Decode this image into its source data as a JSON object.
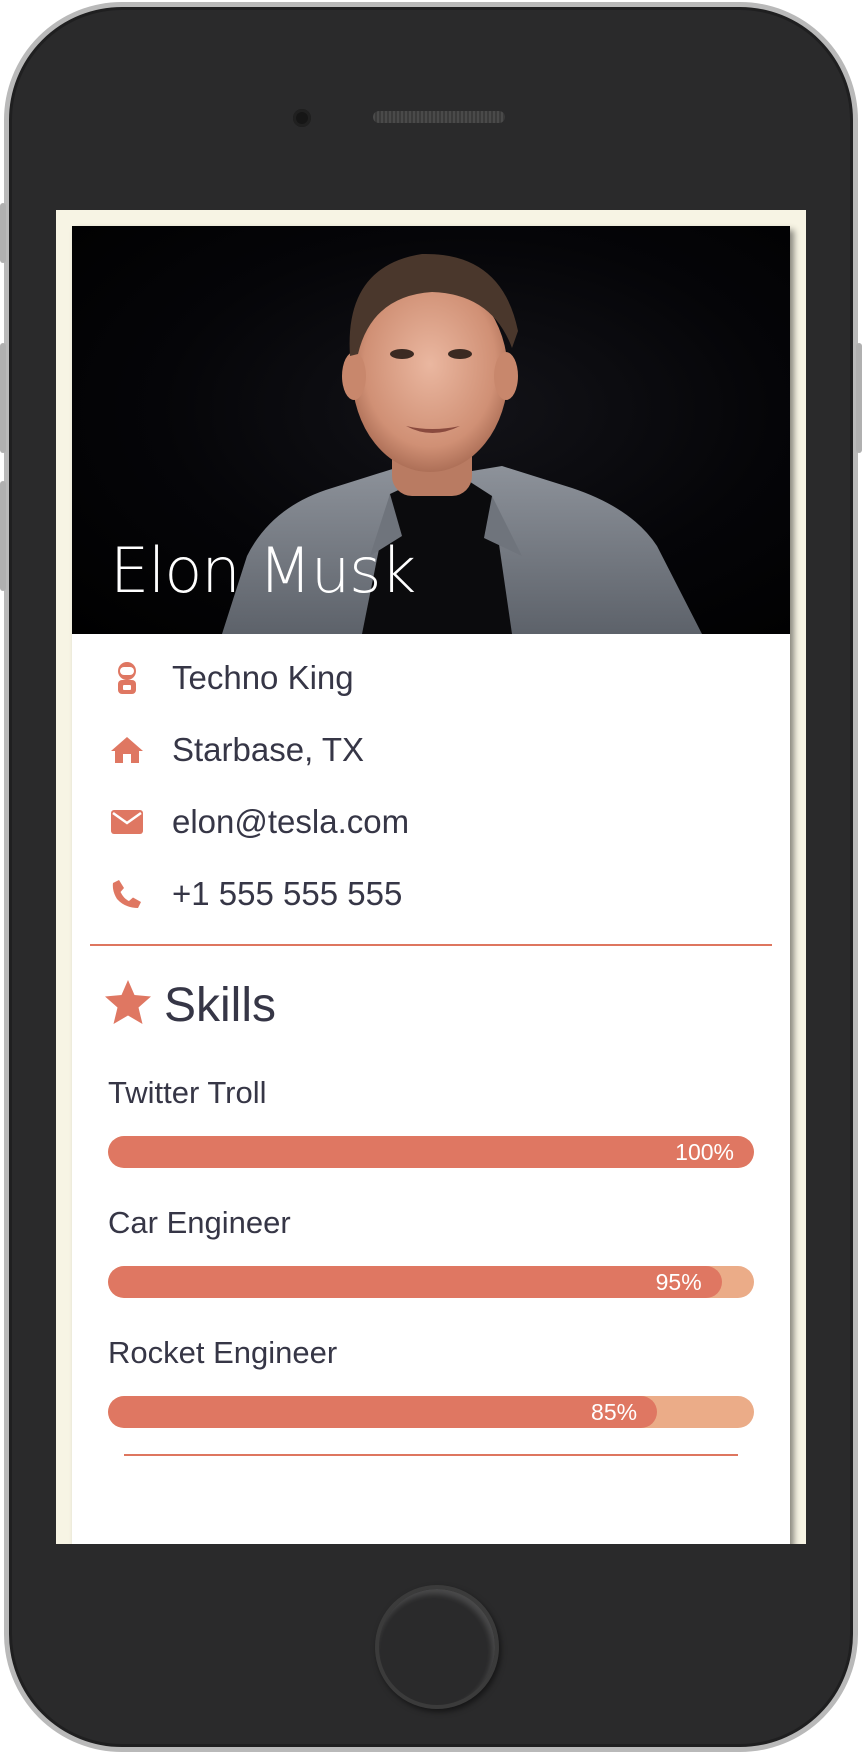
{
  "profile": {
    "name": "Elon Musk",
    "photo_icon": "portrait-photo"
  },
  "info": [
    {
      "icon": "astronaut-icon",
      "text": "Techno King"
    },
    {
      "icon": "home-icon",
      "text": "Starbase, TX"
    },
    {
      "icon": "envelope-icon",
      "text": "elon@tesla.com"
    },
    {
      "icon": "phone-icon",
      "text": "+1 555 555 555"
    }
  ],
  "skills": {
    "title": "Skills",
    "icon": "star-icon",
    "items": [
      {
        "label": "Twitter Troll",
        "percent_label": "100%",
        "level": 100
      },
      {
        "label": "Car Engineer",
        "percent_label": "95%",
        "level": 95
      },
      {
        "label": "Rocket Engineer",
        "percent_label": "85%",
        "level": 85
      }
    ]
  },
  "colors": {
    "accent": "#DF7762",
    "accent_light": "#EBAC88",
    "text": "#363646",
    "page_background": "#F7F4E4",
    "device_body": "#2A2A2B"
  }
}
